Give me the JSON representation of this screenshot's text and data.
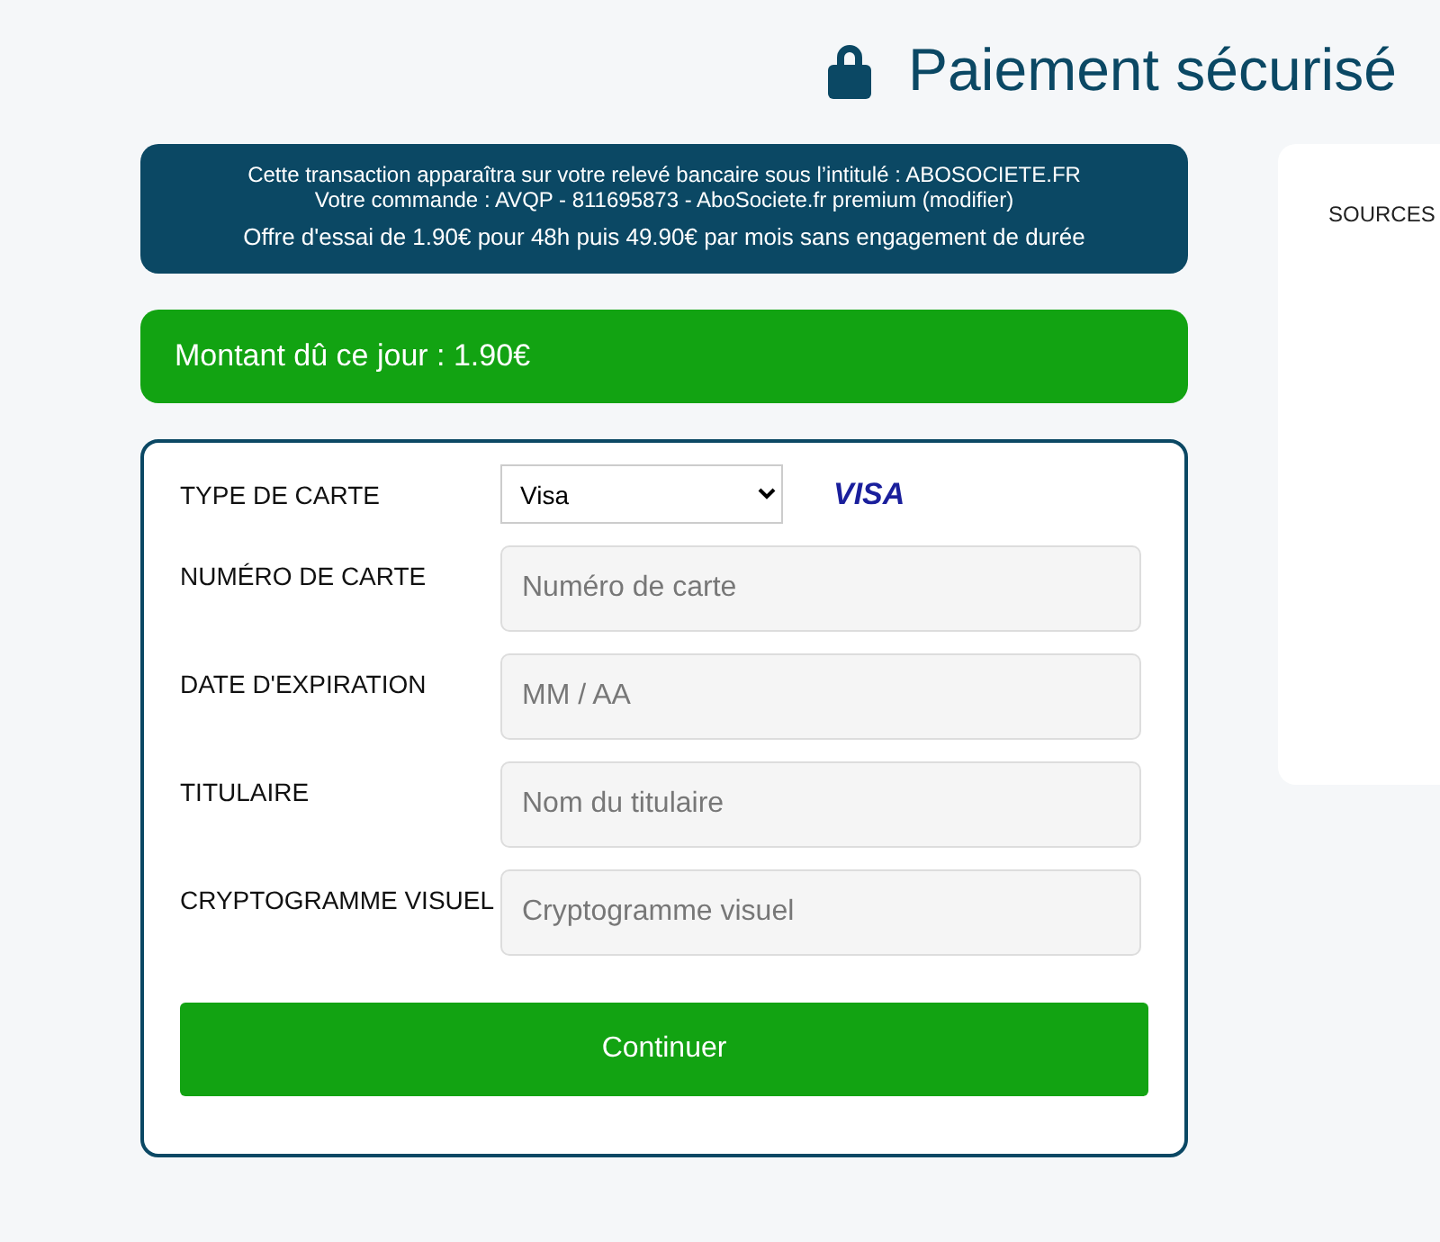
{
  "title": "Paiement sécurisé",
  "notice": {
    "lines": [
      "Cette transaction apparaîtra sur votre relevé bancaire sous l’intitulé : ABOSOCIETE.FR",
      "Votre commande : AVQP - 811695873 - AboSociete.fr premium (modifier)"
    ],
    "offer": "Offre d'essai de 1.90€ pour 48h puis 49.90€ par mois sans engagement de durée"
  },
  "amount": "Montant dû ce jour : 1.90€",
  "fields": [
    {
      "kind": "select",
      "label": "TYPE DE CARTE",
      "value": "Visa",
      "brand": "VISA"
    },
    {
      "kind": "input",
      "label": "NUMÉRO DE CARTE",
      "placeholder": "Numéro de carte"
    },
    {
      "kind": "input",
      "label": "DATE D'EXPIRATION",
      "placeholder": "MM / AA"
    },
    {
      "kind": "input",
      "label": "TITULAIRE",
      "placeholder": "Nom du titulaire"
    },
    {
      "kind": "input",
      "label": "CRYPTOGRAMME VISUEL",
      "placeholder": "Cryptogramme visuel"
    }
  ],
  "submit": "Continuer",
  "side_panel": {
    "label": "SOURCES"
  }
}
